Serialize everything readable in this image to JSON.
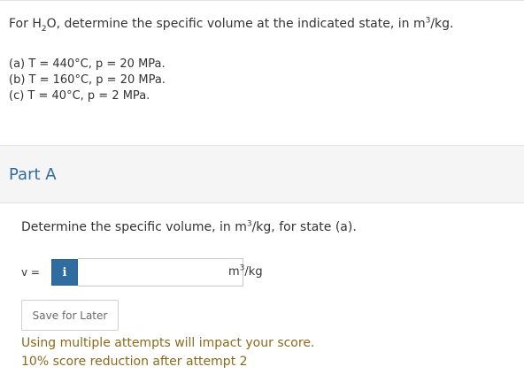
{
  "problem": {
    "statement_prefix": "For H",
    "statement_sub": "2",
    "statement_mid": "O, determine the specific volume at the indicated state, in m",
    "statement_sup": "3",
    "statement_suffix": "/kg.",
    "conditions": [
      "(a) T = 440°C, p = 20 MPa.",
      "(b) T = 160°C, p = 20 MPa.",
      "(c) T = 40°C, p = 2 MPa."
    ]
  },
  "part": {
    "title": "Part A",
    "question_prefix": "Determine the specific volume, in m",
    "question_sup": "3",
    "question_suffix": "/kg, for state (a)."
  },
  "answer": {
    "variable_label": "v =",
    "info_icon_label": "i",
    "input_value": "",
    "input_placeholder": "",
    "unit_prefix": "m",
    "unit_sup": "3",
    "unit_suffix": "/kg"
  },
  "actions": {
    "save_label": "Save for Later"
  },
  "notes": {
    "attempts_line1": "Using multiple attempts will impact your score.",
    "attempts_line2": "10% score reduction after attempt 2"
  },
  "colors": {
    "accent": "#2f6c9f",
    "note": "#8a6a1e",
    "part_header_bg": "#f5f5f5"
  }
}
